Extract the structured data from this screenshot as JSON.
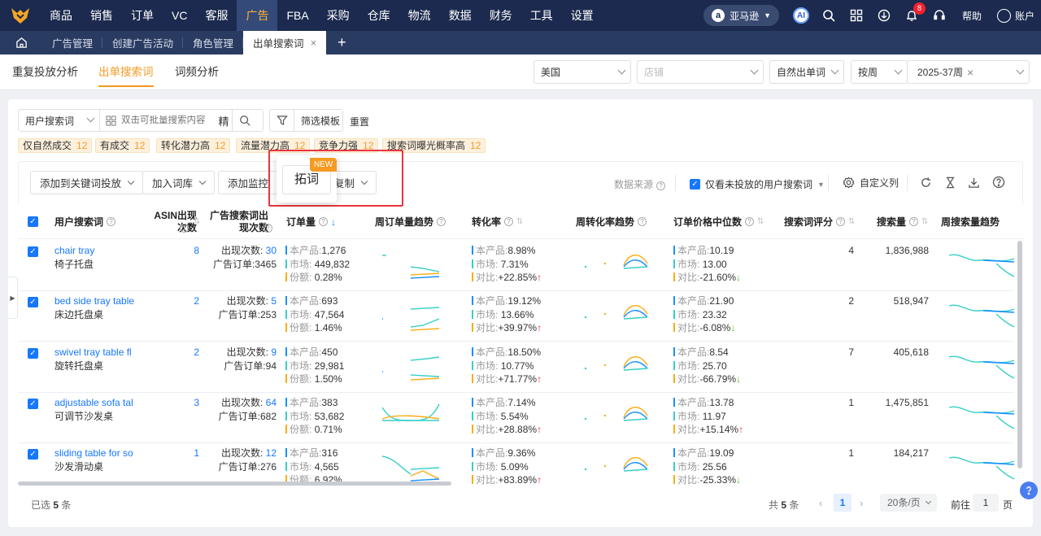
{
  "nav": {
    "items": [
      "商品",
      "销售",
      "订单",
      "VC",
      "客服",
      "广告",
      "FBA",
      "采购",
      "仓库",
      "物流",
      "数据",
      "财务",
      "工具",
      "设置"
    ],
    "active_index": 5,
    "marketplace": "亚马逊",
    "ai_label": "AI",
    "notification_count": "8",
    "help": "帮助",
    "account": "账户"
  },
  "tabs": {
    "items": [
      "广告管理",
      "创建广告活动",
      "角色管理",
      "出单搜索词"
    ],
    "active_index": 3,
    "close": "×",
    "add": "+"
  },
  "subtabs": [
    "重复投放分析",
    "出单搜索词",
    "词频分析"
  ],
  "filters": {
    "country": "美国",
    "store_placeholder": "店铺",
    "term_type": "自然出单词",
    "period_type": "按周",
    "period_value": "2025-37周"
  },
  "search": {
    "field": "用户搜索词",
    "placeholder": "双击可批量搜索内容",
    "exact": "精",
    "template": "筛选模板",
    "reset": "重置"
  },
  "chips": [
    {
      "label": "仅自然成交",
      "count": "12"
    },
    {
      "label": "有成交",
      "count": "12"
    },
    {
      "label": "转化潜力高",
      "count": "12"
    },
    {
      "label": "流量潜力高",
      "count": "12"
    },
    {
      "label": "竞争力强",
      "count": "12"
    },
    {
      "label": "搜索词曝光概率高",
      "count": "12"
    }
  ],
  "toolbar": {
    "add_to_keyword": "添加到关键词投放",
    "add_to_library": "加入词库",
    "add_monitor": "添加监控",
    "copy": "复制",
    "data_source": "数据来源",
    "only_unplaced": "仅看未投放的用户搜索词",
    "custom_columns": "自定义列"
  },
  "popup": {
    "button": "拓词",
    "tag": "NEW"
  },
  "columns": [
    "用户搜索词",
    "ASIN出现次数",
    "广告搜索词出现次数",
    "订单量",
    "周订单量趋势",
    "转化率",
    "周转化率趋势",
    "订单价格中位数",
    "搜索词评分",
    "搜索量",
    "周搜索量趋势"
  ],
  "labels": {
    "appear": "出现次数:",
    "ad_orders": "广告订单:",
    "product": "本产品:",
    "market": "市场:",
    "share": "份额:",
    "compare": "对比:"
  },
  "rows": [
    {
      "kw": "chair tray",
      "cn": "椅子托盘",
      "asin": "8",
      "appear": "30",
      "ad_orders": "3465",
      "orders": "1,276",
      "mkt_orders": "449,832",
      "share": "0.28%",
      "conv": "8.98%",
      "mkt_conv": "7.31%",
      "conv_cmp": "+22.85%",
      "conv_dir": "up",
      "price": "10.19",
      "mkt_price": "13.00",
      "price_cmp": "-21.60%",
      "price_dir": "down",
      "score": "4",
      "volume": "1,836,988"
    },
    {
      "kw": "bed side tray table",
      "cn": "床边托盘桌",
      "asin": "2",
      "appear": "5",
      "ad_orders": "253",
      "orders": "693",
      "mkt_orders": "47,564",
      "share": "1.46%",
      "conv": "19.12%",
      "mkt_conv": "13.66%",
      "conv_cmp": "+39.97%",
      "conv_dir": "up",
      "price": "21.90",
      "mkt_price": "23.32",
      "price_cmp": "-6.08%",
      "price_dir": "down",
      "score": "2",
      "volume": "518,947"
    },
    {
      "kw": "swivel tray table fl",
      "cn": "旋转托盘桌",
      "asin": "2",
      "appear": "9",
      "ad_orders": "94",
      "orders": "450",
      "mkt_orders": "29,981",
      "share": "1.50%",
      "conv": "18.50%",
      "mkt_conv": "10.77%",
      "conv_cmp": "+71.77%",
      "conv_dir": "up",
      "price": "8.54",
      "mkt_price": "25.70",
      "price_cmp": "-66.79%",
      "price_dir": "down",
      "score": "7",
      "volume": "405,618"
    },
    {
      "kw": "adjustable sofa tal",
      "cn": "可调节沙发桌",
      "asin": "3",
      "appear": "64",
      "ad_orders": "682",
      "orders": "383",
      "mkt_orders": "53,682",
      "share": "0.71%",
      "conv": "7.14%",
      "mkt_conv": "5.54%",
      "conv_cmp": "+28.88%",
      "conv_dir": "up",
      "price": "13.78",
      "mkt_price": "11.97",
      "price_cmp": "+15.14%",
      "price_dir": "up",
      "score": "1",
      "volume": "1,475,851"
    },
    {
      "kw": "sliding table for so",
      "cn": "沙发滑动桌",
      "asin": "1",
      "appear": "12",
      "ad_orders": "276",
      "orders": "316",
      "mkt_orders": "4,565",
      "share": "6.92%",
      "conv": "9.36%",
      "mkt_conv": "5.09%",
      "conv_cmp": "+83.89%",
      "conv_dir": "up",
      "price": "19.09",
      "mkt_price": "25.56",
      "price_cmp": "-25.33%",
      "price_dir": "down",
      "score": "1",
      "volume": "184,217"
    }
  ],
  "footer": {
    "selected_prefix": "已选",
    "selected_count": "5",
    "selected_suffix": "条",
    "total_prefix": "共",
    "total": "5",
    "total_suffix": "条",
    "page": "1",
    "page_size": "20条/页",
    "goto_prefix": "前往",
    "goto_value": "1",
    "goto_suffix": "页"
  },
  "colors": {
    "nav_bg": "#1b2a4e",
    "accent": "#f59a23",
    "link": "#1677ff",
    "product_bar": "#1890ff",
    "market_bar": "#36cfc9",
    "share_bar": "#faad14",
    "highlight_border": "#e8363e"
  }
}
